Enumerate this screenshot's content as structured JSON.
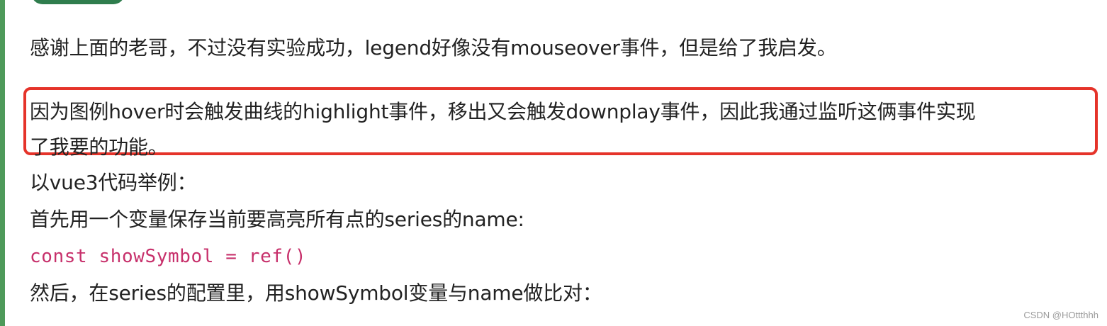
{
  "comment": {
    "lines": [
      "感谢上面的老哥，不过没有实验成功，legend好像没有mouseover事件，但是给了我启发。",
      "因为图例hover时会触发曲线的highlight事件，移出又会触发downplay事件，因此我通过监听这俩事件实现",
      "了我要的功能。",
      "以vue3代码举例：",
      "首先用一个变量保存当前要高亮所有点的series的name:",
      "然后，在series的配置里，用showSymbol变量与name做比对："
    ],
    "code_line": "const showSymbol = ref()"
  },
  "watermark": "CSDN @HOttthhh",
  "colors": {
    "left_border": "#4e9a5a",
    "tab": "#2f7d4d",
    "highlight_box": "#e5332a",
    "code_text": "#c7306b"
  }
}
